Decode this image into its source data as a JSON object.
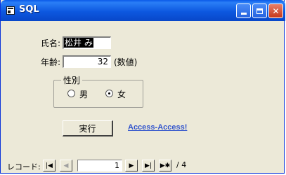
{
  "window": {
    "title": "SQL"
  },
  "form": {
    "name_label": "氏名:",
    "name_value": "松井 み",
    "age_label": "年齢:",
    "age_value": "32",
    "age_note": "(数値)",
    "gender_group_label": "性別",
    "gender_options": [
      {
        "label": "男",
        "checked": false
      },
      {
        "label": "女",
        "checked": true
      }
    ],
    "run_button_label": "実行",
    "link_text": "Access-Access!"
  },
  "navigation": {
    "label": "レコード:",
    "first_glyph": "|◀",
    "prev_glyph": "◀",
    "current_record": "1",
    "next_glyph": "▶",
    "last_glyph": "▶|",
    "new_glyph": "▶✱",
    "total_text": "/ 4"
  },
  "colors": {
    "window_bg": "#ece9d8",
    "titlebar": "#0a5ae8",
    "link": "#3355cc"
  }
}
